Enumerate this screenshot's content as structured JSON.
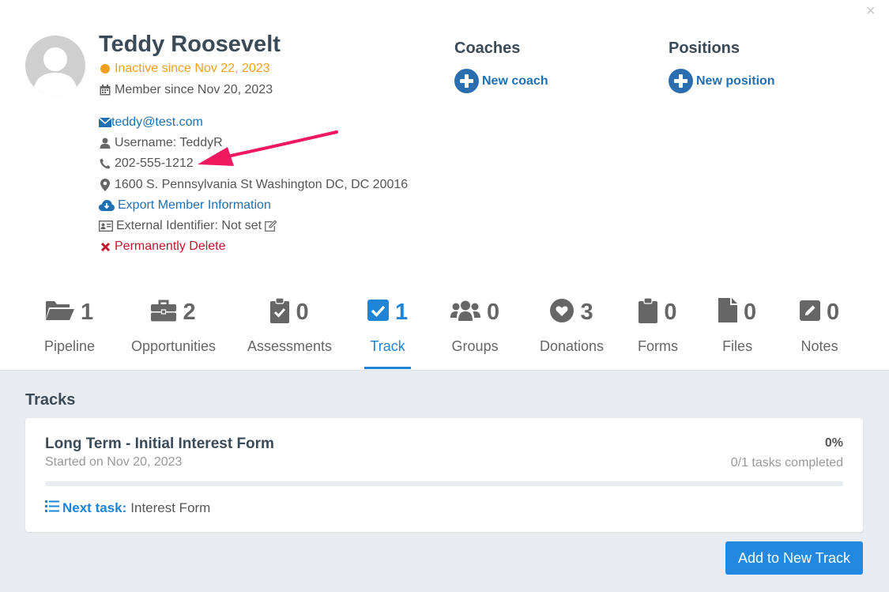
{
  "close_label": "×",
  "profile": {
    "name": "Teddy Roosevelt",
    "status": "Inactive since Nov 22, 2023",
    "member_since": "Member since Nov 20, 2023",
    "email": "teddy@test.com",
    "username": "Username: TeddyR",
    "phone": "202-555-1212",
    "address": "1600 S. Pennsylvania St Washington DC, DC 20016",
    "export_label": "Export Member Information",
    "external_id": "External Identifier: Not set",
    "delete_label": "Permanently Delete"
  },
  "coaches": {
    "title": "Coaches",
    "add_label": "New coach"
  },
  "positions": {
    "title": "Positions",
    "add_label": "New position"
  },
  "tabs": [
    {
      "label": "Pipeline",
      "count": "1",
      "icon": "folder-open-icon"
    },
    {
      "label": "Opportunities",
      "count": "2",
      "icon": "briefcase-icon"
    },
    {
      "label": "Assessments",
      "count": "0",
      "icon": "clipboard-check-icon"
    },
    {
      "label": "Track",
      "count": "1",
      "icon": "check-square-icon",
      "active": true
    },
    {
      "label": "Groups",
      "count": "0",
      "icon": "users-icon"
    },
    {
      "label": "Donations",
      "count": "3",
      "icon": "heart-circle-icon"
    },
    {
      "label": "Forms",
      "count": "0",
      "icon": "clipboard-icon"
    },
    {
      "label": "Files",
      "count": "0",
      "icon": "file-icon"
    },
    {
      "label": "Notes",
      "count": "0",
      "icon": "edit-icon"
    }
  ],
  "tracks": {
    "title": "Tracks",
    "card": {
      "title": "Long Term - Initial Interest Form",
      "started": "Started on Nov 20, 2023",
      "percent": "0%",
      "progress_fraction": 0,
      "tasks_completed": "0/1 tasks completed",
      "next_task_label": "Next task:",
      "next_task_value": "Interest Form"
    },
    "add_button": "Add to New Track"
  },
  "colors": {
    "accent": "#1f83d6",
    "status_inactive": "#f0a020",
    "danger": "#c0152f",
    "annotation_arrow": "#f0195f"
  }
}
